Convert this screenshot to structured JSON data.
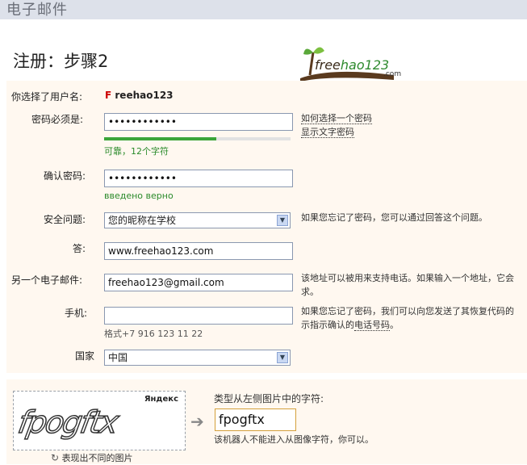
{
  "header": {
    "title": "电子邮件"
  },
  "page": {
    "title": "注册：步骤2"
  },
  "logo": {
    "text_a": "free",
    "text_b": "hao123",
    "suffix": ".com"
  },
  "username": {
    "label": "你选择了用户名:",
    "value_initial": "F",
    "value_rest": "reehao123"
  },
  "password": {
    "label": "密码必须是:",
    "value": "••••••••••••",
    "strength_text": "可靠，12个字符",
    "strength_fraction": 0.6,
    "help_link": "如何选择一个密码",
    "show_link": "显示文字密码"
  },
  "confirm": {
    "label": "确认密码:",
    "value": "••••••••••••",
    "status": "введено верно"
  },
  "security_question": {
    "label": "安全问题:",
    "value": "您的昵称在学校",
    "hint": "如果您忘记了密码，您可以通过回答这个问题。"
  },
  "answer": {
    "label": "答:",
    "value": "www.freehao123.com"
  },
  "alt_email": {
    "label": "另一个电子邮件:",
    "value": "freehao123@gmail.com",
    "hint_line1": "该地址可以被用来支持电话。如果输入一个地址，它会",
    "hint_line2": "求。"
  },
  "phone": {
    "label": "手机:",
    "value": "",
    "format": "格式+7 916 123 11 22",
    "hint_line1": "如果您忘记了密码，我们可以向您发送了其恢复代码的",
    "hint_line2_pre": "示指示确认的",
    "hint_line2_link": "电话号码",
    "hint_line2_post": "。"
  },
  "country": {
    "label": "国家",
    "value": "中国"
  },
  "captcha": {
    "brand": "Яндекс",
    "image_text": "fpogftx",
    "prompt": "类型从左侧图片中的字符:",
    "value": "fpogftx",
    "note": "该机器人不能进入从图像字符，你可以。",
    "refresh": "表现出不同的图片"
  }
}
